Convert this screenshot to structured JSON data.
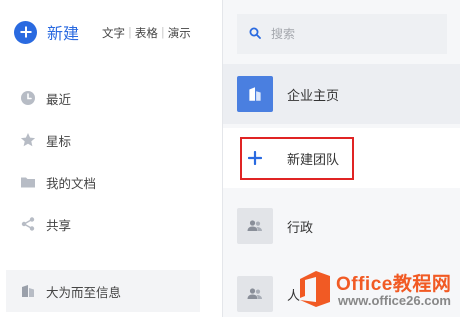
{
  "new_section": {
    "label": "新建",
    "types": [
      "文字",
      "表格",
      "演示"
    ]
  },
  "nav": {
    "items": [
      {
        "label": "最近",
        "icon": "clock-icon"
      },
      {
        "label": "星标",
        "icon": "star-icon"
      },
      {
        "label": "我的文档",
        "icon": "folder-icon"
      },
      {
        "label": "共享",
        "icon": "share-icon"
      }
    ],
    "info_label": "大为而至信息",
    "info_icon": "building-icon"
  },
  "search": {
    "placeholder": "搜索",
    "icon": "search-icon"
  },
  "teams": {
    "items": [
      {
        "label": "企业主页",
        "icon": "building-icon",
        "state": "active"
      },
      {
        "label": "新建团队",
        "icon": "plus-icon",
        "state": "highlighted"
      },
      {
        "label": "行政",
        "icon": "people-icon",
        "state": "normal"
      },
      {
        "label": "人",
        "icon": "people-icon",
        "state": "normal"
      }
    ]
  },
  "watermark": {
    "title": "Office教程网",
    "url": "www.office26.com"
  },
  "colors": {
    "accent": "#2a6ae0",
    "highlight_border": "#e02424",
    "watermark_orange": "#f15a24"
  }
}
